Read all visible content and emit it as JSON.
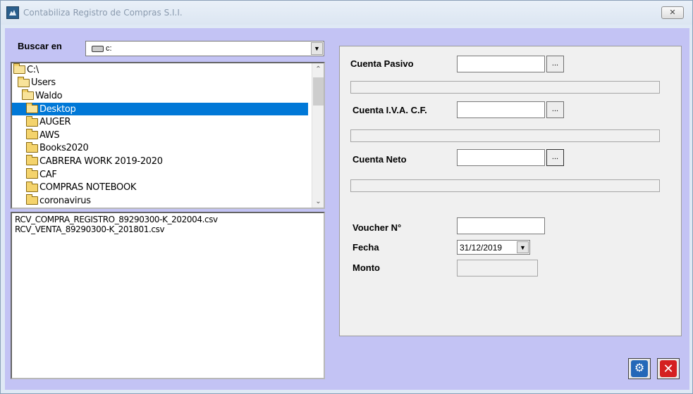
{
  "window": {
    "title": "Contabiliza Registro de Compras S.I.I.",
    "close_glyph": "✕"
  },
  "search": {
    "label": "Buscar en",
    "drive_value": "c:",
    "dropdown_glyph": "▼"
  },
  "directories": [
    {
      "name": "C:\\",
      "icon": "open-folder-icon",
      "indent": 0,
      "selected": false
    },
    {
      "name": "Users",
      "icon": "open-folder-icon",
      "indent": 1,
      "selected": false
    },
    {
      "name": "Waldo",
      "icon": "open-folder-icon",
      "indent": 2,
      "selected": false
    },
    {
      "name": "Desktop",
      "icon": "open-folder-icon",
      "indent": 3,
      "selected": true
    },
    {
      "name": "AUGER",
      "icon": "folder-icon",
      "indent": 4,
      "selected": false
    },
    {
      "name": "AWS",
      "icon": "folder-icon",
      "indent": 4,
      "selected": false
    },
    {
      "name": "Books2020",
      "icon": "folder-icon",
      "indent": 4,
      "selected": false
    },
    {
      "name": "CABRERA WORK 2019-2020",
      "icon": "folder-icon",
      "indent": 4,
      "selected": false
    },
    {
      "name": "CAF",
      "icon": "folder-icon",
      "indent": 4,
      "selected": false
    },
    {
      "name": "COMPRAS NOTEBOOK",
      "icon": "folder-icon",
      "indent": 4,
      "selected": false
    },
    {
      "name": "coronavirus",
      "icon": "folder-icon",
      "indent": 4,
      "selected": false
    }
  ],
  "scrollbar": {
    "up": "⌃",
    "down": "⌄"
  },
  "files": [
    "RCV_COMPRA_REGISTRO_89290300-K_202004.csv",
    "RCV_VENTA_89290300-K_201801.csv"
  ],
  "form": {
    "cuenta_pasivo_label": "Cuenta Pasivo",
    "cuenta_iva_label": "Cuenta I.V.A. C.F.",
    "cuenta_neto_label": "Cuenta Neto",
    "browse_label": "...",
    "voucher_label": "Voucher N°",
    "fecha_label": "Fecha",
    "fecha_value": "31/12/2019",
    "fecha_dropdown": "▼",
    "monto_label": "Monto"
  },
  "actions": {
    "process_icon": "gears-icon",
    "process_glyph": "⚙",
    "cancel_icon": "close-icon",
    "cancel_glyph": "✕"
  }
}
